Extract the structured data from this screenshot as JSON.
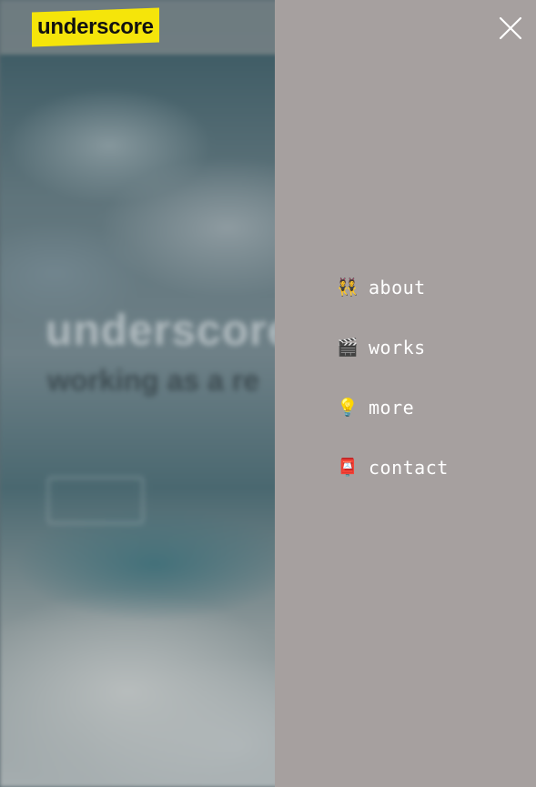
{
  "brand": {
    "logo_text": "underscore",
    "logo_color": "#f5e50a"
  },
  "background_page": {
    "hero_title": "underscore",
    "hero_subtitle": "working as a re"
  },
  "menu": {
    "panel_color": "#a6a09f",
    "close_icon": "close-icon",
    "items": [
      {
        "icon": "👯",
        "icon_name": "dancers-icon",
        "label": "about"
      },
      {
        "icon": "🎬",
        "icon_name": "clapper-board-icon",
        "label": "works"
      },
      {
        "icon": "💡",
        "icon_name": "light-bulb-icon",
        "label": "more"
      },
      {
        "icon": "📮",
        "icon_name": "postbox-icon",
        "label": "contact"
      }
    ]
  }
}
